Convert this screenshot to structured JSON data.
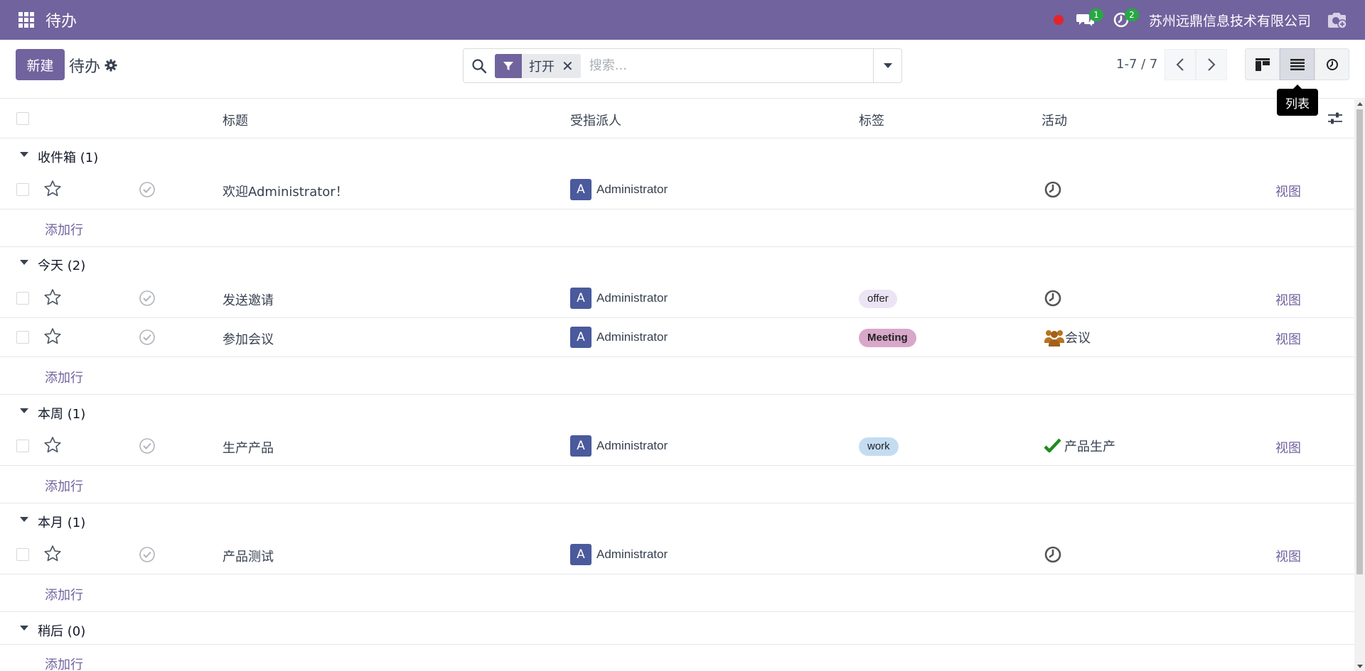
{
  "app": {
    "title": "待办"
  },
  "navbar": {
    "messages_count": "1",
    "activities_count": "2",
    "company": "苏州远鼎信息技术有限公司"
  },
  "control": {
    "new_label": "新建",
    "breadcrumb": "待办",
    "facet_label": "打开",
    "facet_remove": "✕",
    "search_placeholder": "搜索...",
    "pager": "1-7 / 7",
    "tooltip": "列表"
  },
  "columns": {
    "title": "标题",
    "assignee": "受指派人",
    "tags": "标签",
    "activity": "活动"
  },
  "groups": [
    {
      "label": "收件箱 (1)",
      "rows": [
        {
          "title": "欢迎Administrator！",
          "avatar": "A",
          "assignee": "Administrator",
          "tag": "",
          "activity_icon": "clock-icon",
          "activity": "",
          "view": "视图"
        }
      ]
    },
    {
      "label": "今天 (2)",
      "rows": [
        {
          "title": "发送邀请",
          "avatar": "A",
          "assignee": "Administrator",
          "tag": "offer",
          "activity_icon": "clock-icon",
          "activity": "",
          "view": "视图"
        },
        {
          "title": "参加会议",
          "avatar": "A",
          "assignee": "Administrator",
          "tag": "Meeting",
          "activity_icon": "users-icon",
          "activity": "会议",
          "view": "视图"
        }
      ]
    },
    {
      "label": "本周 (1)",
      "rows": [
        {
          "title": "生产产品",
          "avatar": "A",
          "assignee": "Administrator",
          "tag": "work",
          "activity_icon": "check-icon",
          "activity": "产品生产",
          "view": "视图"
        }
      ]
    },
    {
      "label": "本月 (1)",
      "rows": [
        {
          "title": "产品测试",
          "avatar": "A",
          "assignee": "Administrator",
          "tag": "",
          "activity_icon": "clock-icon",
          "activity": "",
          "view": "视图"
        }
      ]
    },
    {
      "label": "稍后 (0)",
      "rows": []
    }
  ],
  "add_line_label": "添加行",
  "colors": {
    "brand": "#71639e",
    "tag_offer": "#ece4f5",
    "tag_meeting": "#d8a7c9",
    "tag_work": "#c4dcf2",
    "done_check": "#228b22"
  }
}
